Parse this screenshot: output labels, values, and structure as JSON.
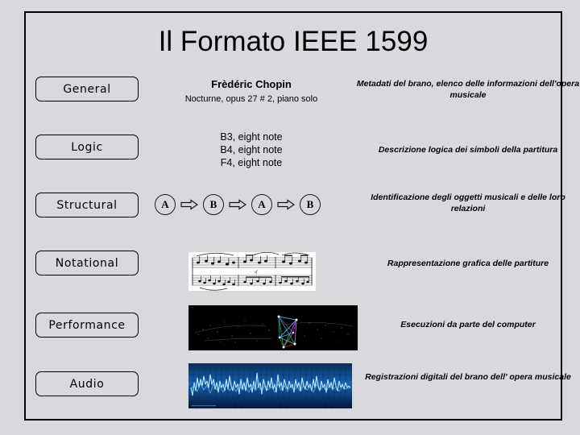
{
  "slide": {
    "title": "Il Formato IEEE 1599",
    "background_color": "#d7d9dd",
    "frame_border_color": "#000000"
  },
  "layers": [
    {
      "id": "general",
      "button_label": "General",
      "content_title": "Frèdéric Chopin",
      "content_subtitle": "Nocturne, opus 27 # 2, piano solo",
      "description": "Metadati del brano, elenco delle informazioni dell'opera musicale",
      "media": "none"
    },
    {
      "id": "logic",
      "button_label": "Logic",
      "notes": [
        "B3, eight note",
        "B4, eight note",
        "F4, eight note"
      ],
      "description": "Descrizione logica dei simboli della partitura",
      "media": "none"
    },
    {
      "id": "structural",
      "button_label": "Structural",
      "chain": [
        "A",
        "B",
        "A",
        "B"
      ],
      "description": "Identificazione degli oggetti musicali e delle loro relazioni",
      "media": "chain-diagram"
    },
    {
      "id": "notational",
      "button_label": "Notational",
      "description": "Rappresentazione grafica delle partiture",
      "media": "score-image"
    },
    {
      "id": "performance",
      "button_label": "Performance",
      "description": "Esecuzioni da parte del computer",
      "media": "performance-visualization"
    },
    {
      "id": "audio",
      "button_label": "Audio",
      "description": "Registrazioni digitali del brano dell' opera musicale",
      "media": "audio-waveform"
    }
  ],
  "icons": {
    "arrow": "right-arrow-icon"
  }
}
